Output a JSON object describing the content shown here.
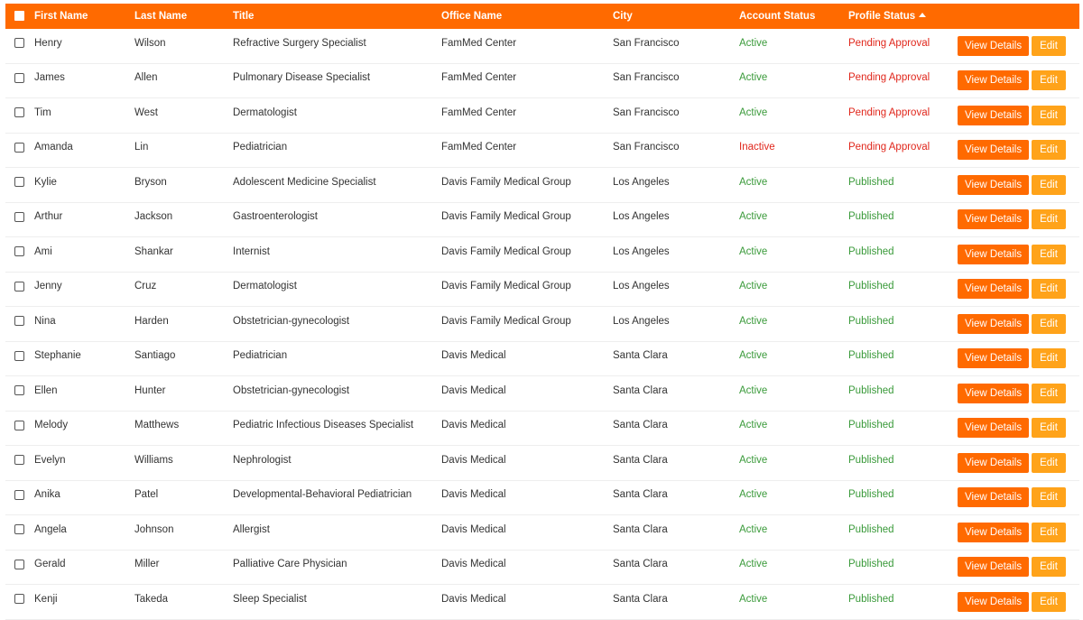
{
  "table": {
    "columns": {
      "first_name": "First Name",
      "last_name": "Last Name",
      "title": "Title",
      "office_name": "Office Name",
      "city": "City",
      "account_status": "Account Status",
      "profile_status": "Profile Status"
    },
    "sort": {
      "column": "profile_status",
      "direction": "ascending"
    },
    "buttons": {
      "view_details": "View Details",
      "edit": "Edit"
    },
    "colors": {
      "header_bg": "#ff6a00",
      "view_button": "#ff6a00",
      "edit_button": "#ffa31a",
      "status_green": "#3a9a3a",
      "status_red": "#e0261b"
    },
    "rows": [
      {
        "first": "Henry",
        "last": "Wilson",
        "title": "Refractive Surgery Specialist",
        "office": "FamMed Center",
        "city": "San Francisco",
        "account": "Active",
        "profile": "Pending Approval"
      },
      {
        "first": "James",
        "last": "Allen",
        "title": "Pulmonary Disease Specialist",
        "office": "FamMed Center",
        "city": "San Francisco",
        "account": "Active",
        "profile": "Pending Approval"
      },
      {
        "first": "Tim",
        "last": "West",
        "title": "Dermatologist",
        "office": "FamMed Center",
        "city": "San Francisco",
        "account": "Active",
        "profile": "Pending Approval"
      },
      {
        "first": "Amanda",
        "last": "Lin",
        "title": "Pediatrician",
        "office": "FamMed Center",
        "city": "San Francisco",
        "account": "Inactive",
        "profile": "Pending Approval"
      },
      {
        "first": "Kylie",
        "last": "Bryson",
        "title": "Adolescent Medicine Specialist",
        "office": "Davis Family Medical Group",
        "city": "Los Angeles",
        "account": "Active",
        "profile": "Published"
      },
      {
        "first": "Arthur",
        "last": "Jackson",
        "title": "Gastroenterologist",
        "office": "Davis Family Medical Group",
        "city": "Los Angeles",
        "account": "Active",
        "profile": "Published"
      },
      {
        "first": "Ami",
        "last": "Shankar",
        "title": "Internist",
        "office": "Davis Family Medical Group",
        "city": "Los Angeles",
        "account": "Active",
        "profile": "Published"
      },
      {
        "first": "Jenny",
        "last": "Cruz",
        "title": "Dermatologist",
        "office": "Davis Family Medical Group",
        "city": "Los Angeles",
        "account": "Active",
        "profile": "Published"
      },
      {
        "first": "Nina",
        "last": "Harden",
        "title": "Obstetrician-gynecologist",
        "office": "Davis Family Medical Group",
        "city": "Los Angeles",
        "account": "Active",
        "profile": "Published"
      },
      {
        "first": "Stephanie",
        "last": "Santiago",
        "title": "Pediatrician",
        "office": "Davis Medical",
        "city": "Santa Clara",
        "account": "Active",
        "profile": "Published"
      },
      {
        "first": "Ellen",
        "last": "Hunter",
        "title": "Obstetrician-gynecologist",
        "office": "Davis Medical",
        "city": "Santa Clara",
        "account": "Active",
        "profile": "Published"
      },
      {
        "first": "Melody",
        "last": "Matthews",
        "title": "Pediatric Infectious Diseases Specialist",
        "office": "Davis Medical",
        "city": "Santa Clara",
        "account": "Active",
        "profile": "Published"
      },
      {
        "first": "Evelyn",
        "last": "Williams",
        "title": "Nephrologist",
        "office": "Davis Medical",
        "city": "Santa Clara",
        "account": "Active",
        "profile": "Published"
      },
      {
        "first": "Anika",
        "last": "Patel",
        "title": "Developmental-Behavioral Pediatrician",
        "office": "Davis Medical",
        "city": "Santa Clara",
        "account": "Active",
        "profile": "Published"
      },
      {
        "first": "Angela",
        "last": "Johnson",
        "title": "Allergist",
        "office": "Davis Medical",
        "city": "Santa Clara",
        "account": "Active",
        "profile": "Published"
      },
      {
        "first": "Gerald",
        "last": "Miller",
        "title": "Palliative Care Physician",
        "office": "Davis Medical",
        "city": "Santa Clara",
        "account": "Active",
        "profile": "Published"
      },
      {
        "first": "Kenji",
        "last": "Takeda",
        "title": "Sleep Specialist",
        "office": "Davis Medical",
        "city": "Santa Clara",
        "account": "Active",
        "profile": "Published"
      }
    ]
  }
}
